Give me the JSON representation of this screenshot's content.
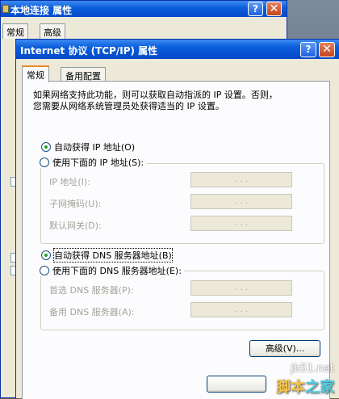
{
  "back_window": {
    "title": "本地连接 属性",
    "help_button": "?",
    "close_button": "✕",
    "tabs": [
      {
        "label": "常规"
      },
      {
        "label": "高级"
      }
    ]
  },
  "dialog": {
    "title": "Internet 协议 (TCP/IP) 属性",
    "help_button": "?",
    "close_button": "✕",
    "tabs": [
      {
        "label": "常规",
        "active": true
      },
      {
        "label": "备用配置",
        "active": false
      }
    ],
    "description_line1": "如果网络支持此功能，则可以获取自动指派的 IP 设置。否则，",
    "description_line2": "您需要从网络系统管理员处获得适当的 IP 设置。",
    "ip_auto_label": "自动获得 IP 地址(O)",
    "ip_manual_label": "使用下面的 IP 地址(S):",
    "ip_fields": [
      {
        "label": "IP 地址(I):",
        "value": ". . ."
      },
      {
        "label": "子网掩码(U):",
        "value": ". . ."
      },
      {
        "label": "默认网关(D):",
        "value": ". . ."
      }
    ],
    "dns_auto_label": "自动获得 DNS 服务器地址(B)",
    "dns_manual_label": "使用下面的 DNS 服务器地址(E):",
    "dns_fields": [
      {
        "label": "首选 DNS 服务器(P):",
        "value": ". . ."
      },
      {
        "label": "备用 DNS 服务器(A):",
        "value": ". . ."
      }
    ],
    "advanced_button": "高级(V)...",
    "selection": {
      "ip": "auto",
      "dns": "auto"
    }
  },
  "watermark": {
    "site": "jb51.net",
    "logo_1": "脚本",
    "logo_2": "之家"
  },
  "colors": {
    "title_bar": "#0a5ddb",
    "dialog_bg": "#ece9d8",
    "tab_highlight": "#e68b2c",
    "radio_dot": "#21a121"
  }
}
